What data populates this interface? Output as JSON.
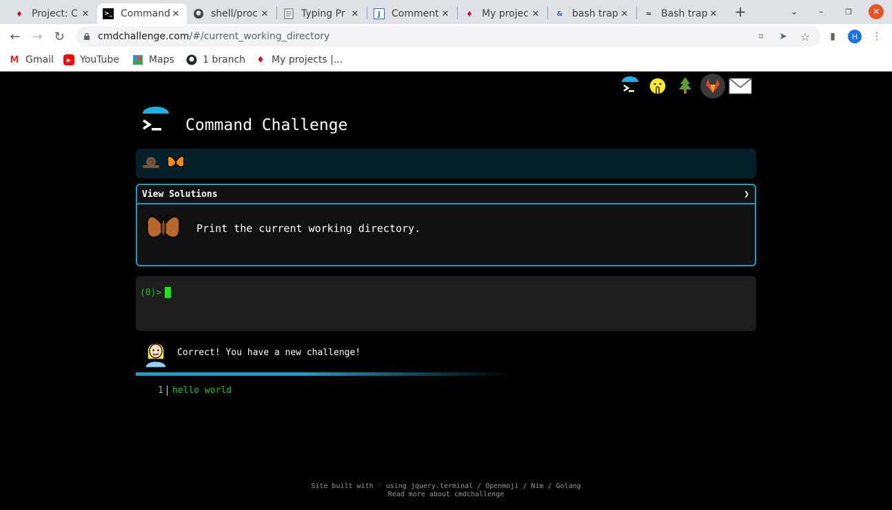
{
  "browser": {
    "tabs": [
      {
        "title": "Project: C",
        "icon": "red-ruby-icon",
        "active": false
      },
      {
        "title": "Command",
        "icon": "terminal-icon",
        "active": true
      },
      {
        "title": "shell/proc",
        "icon": "github-icon",
        "active": false
      },
      {
        "title": "Typing Pr",
        "icon": "doc-icon",
        "active": false
      },
      {
        "title": "Comment",
        "icon": "j-icon",
        "active": false
      },
      {
        "title": "My projec",
        "icon": "red-ruby-icon",
        "active": false
      },
      {
        "title": "bash trap",
        "icon": "bash-icon",
        "active": false
      },
      {
        "title": "Bash trap",
        "icon": "bash-icon",
        "active": false
      }
    ],
    "new_tab": "+",
    "url_host": "cmdchallenge.com",
    "url_path": "/#/current_working_directory",
    "profile_initial": "H",
    "bookmarks": [
      {
        "label": "Gmail",
        "icon": "gmail-icon",
        "color": "#d93025"
      },
      {
        "label": "YouTube",
        "icon": "youtube-icon",
        "color": "#ff0000"
      },
      {
        "label": "Maps",
        "icon": "maps-icon",
        "color": "#34a853"
      },
      {
        "label": "1 branch",
        "icon": "github-icon",
        "color": "#24292e"
      },
      {
        "label": "My projects |...",
        "icon": "red-ruby-icon",
        "color": "#c8102e"
      }
    ]
  },
  "page": {
    "title": "Command Challenge",
    "view_solutions": "View Solutions",
    "chevron": "❯",
    "challenge_text": "Print the current working directory.",
    "prompt": "(0)>",
    "feedback": "Correct! You have a new challenge!",
    "output_lines": [
      {
        "n": "1",
        "text": "hello world"
      }
    ],
    "footer_line1": "Site built with ♡ using jquery.terminal / Openmoji / Nim / Golang",
    "footer_line2": "Read more about cmdchallenge",
    "accent": "#1a9fc4",
    "term_green": "#21c521"
  }
}
